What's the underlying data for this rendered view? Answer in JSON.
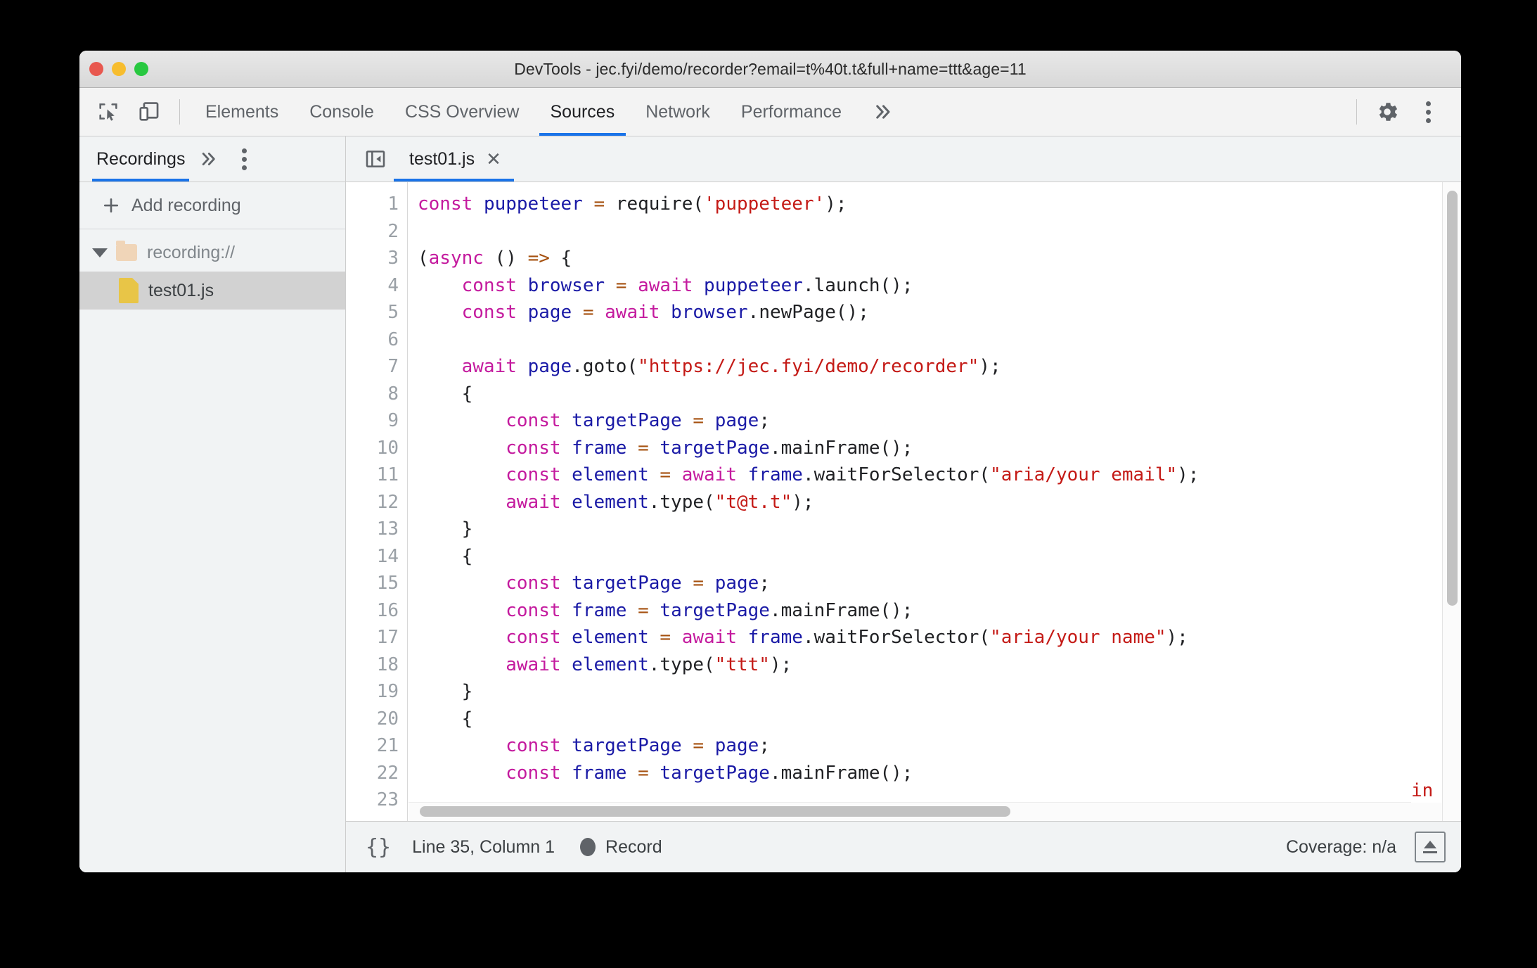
{
  "window": {
    "title": "DevTools - jec.fyi/demo/recorder?email=t%40t.t&full+name=ttt&age=11",
    "traffic_lights": {
      "close_color": "#e8584f",
      "minimize_color": "#f7bd2e",
      "maximize_color": "#28c840"
    }
  },
  "toolbar": {
    "inspect_icon": "inspect-element-icon",
    "device_icon": "device-toolbar-icon",
    "tabs": [
      {
        "label": "Elements",
        "active": false
      },
      {
        "label": "Console",
        "active": false
      },
      {
        "label": "CSS Overview",
        "active": false
      },
      {
        "label": "Sources",
        "active": true
      },
      {
        "label": "Network",
        "active": false
      },
      {
        "label": "Performance",
        "active": false
      }
    ],
    "more_tabs_icon": "chevron-double-right-icon",
    "settings_icon": "gear-icon",
    "menu_icon": "more-vertical-icon",
    "accent_color": "#1a73e8"
  },
  "sidebar": {
    "tab_label": "Recordings",
    "more_icon": "chevron-double-right-icon",
    "menu_icon": "more-vertical-icon",
    "add_recording_label": "Add recording",
    "add_icon": "plus-icon",
    "tree": [
      {
        "label": "recording://",
        "type": "folder",
        "expanded": true,
        "icon": "folder-icon",
        "twisty": "triangle-down-icon"
      },
      {
        "label": "test01.js",
        "type": "file",
        "selected": true,
        "icon": "js-file-icon"
      }
    ]
  },
  "editor": {
    "sidebar_toggle_icon": "show-navigator-icon",
    "tab_label": "test01.js",
    "close_icon": "close-icon",
    "lines": [
      {
        "n": "1",
        "tokens": [
          {
            "t": "const",
            "c": "kw"
          },
          {
            "t": " ",
            "c": "pl"
          },
          {
            "t": "puppeteer",
            "c": "var"
          },
          {
            "t": " ",
            "c": "pl"
          },
          {
            "t": "=",
            "c": "op"
          },
          {
            "t": " require(",
            "c": "pl"
          },
          {
            "t": "'puppeteer'",
            "c": "str"
          },
          {
            "t": ");",
            "c": "pl"
          }
        ]
      },
      {
        "n": "2",
        "tokens": []
      },
      {
        "n": "3",
        "tokens": [
          {
            "t": "(",
            "c": "pl"
          },
          {
            "t": "async",
            "c": "kw"
          },
          {
            "t": " () ",
            "c": "pl"
          },
          {
            "t": "=>",
            "c": "op"
          },
          {
            "t": " {",
            "c": "pl"
          }
        ]
      },
      {
        "n": "4",
        "tokens": [
          {
            "t": "    ",
            "c": "pl"
          },
          {
            "t": "const",
            "c": "kw"
          },
          {
            "t": " ",
            "c": "pl"
          },
          {
            "t": "browser",
            "c": "var"
          },
          {
            "t": " ",
            "c": "pl"
          },
          {
            "t": "=",
            "c": "op"
          },
          {
            "t": " ",
            "c": "pl"
          },
          {
            "t": "await",
            "c": "kw"
          },
          {
            "t": " ",
            "c": "pl"
          },
          {
            "t": "puppeteer",
            "c": "var"
          },
          {
            "t": ".launch();",
            "c": "pl"
          }
        ]
      },
      {
        "n": "5",
        "tokens": [
          {
            "t": "    ",
            "c": "pl"
          },
          {
            "t": "const",
            "c": "kw"
          },
          {
            "t": " ",
            "c": "pl"
          },
          {
            "t": "page",
            "c": "var"
          },
          {
            "t": " ",
            "c": "pl"
          },
          {
            "t": "=",
            "c": "op"
          },
          {
            "t": " ",
            "c": "pl"
          },
          {
            "t": "await",
            "c": "kw"
          },
          {
            "t": " ",
            "c": "pl"
          },
          {
            "t": "browser",
            "c": "var"
          },
          {
            "t": ".newPage();",
            "c": "pl"
          }
        ]
      },
      {
        "n": "6",
        "tokens": []
      },
      {
        "n": "7",
        "tokens": [
          {
            "t": "    ",
            "c": "pl"
          },
          {
            "t": "await",
            "c": "kw"
          },
          {
            "t": " ",
            "c": "pl"
          },
          {
            "t": "page",
            "c": "var"
          },
          {
            "t": ".goto(",
            "c": "pl"
          },
          {
            "t": "\"https://jec.fyi/demo/recorder\"",
            "c": "str"
          },
          {
            "t": ");",
            "c": "pl"
          }
        ]
      },
      {
        "n": "8",
        "tokens": [
          {
            "t": "    {",
            "c": "pl"
          }
        ]
      },
      {
        "n": "9",
        "tokens": [
          {
            "t": "        ",
            "c": "pl"
          },
          {
            "t": "const",
            "c": "kw"
          },
          {
            "t": " ",
            "c": "pl"
          },
          {
            "t": "targetPage",
            "c": "var"
          },
          {
            "t": " ",
            "c": "pl"
          },
          {
            "t": "=",
            "c": "op"
          },
          {
            "t": " ",
            "c": "pl"
          },
          {
            "t": "page",
            "c": "var"
          },
          {
            "t": ";",
            "c": "pl"
          }
        ]
      },
      {
        "n": "10",
        "tokens": [
          {
            "t": "        ",
            "c": "pl"
          },
          {
            "t": "const",
            "c": "kw"
          },
          {
            "t": " ",
            "c": "pl"
          },
          {
            "t": "frame",
            "c": "var"
          },
          {
            "t": " ",
            "c": "pl"
          },
          {
            "t": "=",
            "c": "op"
          },
          {
            "t": " ",
            "c": "pl"
          },
          {
            "t": "targetPage",
            "c": "var"
          },
          {
            "t": ".mainFrame();",
            "c": "pl"
          }
        ]
      },
      {
        "n": "11",
        "tokens": [
          {
            "t": "        ",
            "c": "pl"
          },
          {
            "t": "const",
            "c": "kw"
          },
          {
            "t": " ",
            "c": "pl"
          },
          {
            "t": "element",
            "c": "var"
          },
          {
            "t": " ",
            "c": "pl"
          },
          {
            "t": "=",
            "c": "op"
          },
          {
            "t": " ",
            "c": "pl"
          },
          {
            "t": "await",
            "c": "kw"
          },
          {
            "t": " ",
            "c": "pl"
          },
          {
            "t": "frame",
            "c": "var"
          },
          {
            "t": ".waitForSelector(",
            "c": "pl"
          },
          {
            "t": "\"aria/your email\"",
            "c": "str"
          },
          {
            "t": ");",
            "c": "pl"
          }
        ]
      },
      {
        "n": "12",
        "tokens": [
          {
            "t": "        ",
            "c": "pl"
          },
          {
            "t": "await",
            "c": "kw"
          },
          {
            "t": " ",
            "c": "pl"
          },
          {
            "t": "element",
            "c": "var"
          },
          {
            "t": ".type(",
            "c": "pl"
          },
          {
            "t": "\"t@t.t\"",
            "c": "str"
          },
          {
            "t": ");",
            "c": "pl"
          }
        ]
      },
      {
        "n": "13",
        "tokens": [
          {
            "t": "    }",
            "c": "pl"
          }
        ]
      },
      {
        "n": "14",
        "tokens": [
          {
            "t": "    {",
            "c": "pl"
          }
        ]
      },
      {
        "n": "15",
        "tokens": [
          {
            "t": "        ",
            "c": "pl"
          },
          {
            "t": "const",
            "c": "kw"
          },
          {
            "t": " ",
            "c": "pl"
          },
          {
            "t": "targetPage",
            "c": "var"
          },
          {
            "t": " ",
            "c": "pl"
          },
          {
            "t": "=",
            "c": "op"
          },
          {
            "t": " ",
            "c": "pl"
          },
          {
            "t": "page",
            "c": "var"
          },
          {
            "t": ";",
            "c": "pl"
          }
        ]
      },
      {
        "n": "16",
        "tokens": [
          {
            "t": "        ",
            "c": "pl"
          },
          {
            "t": "const",
            "c": "kw"
          },
          {
            "t": " ",
            "c": "pl"
          },
          {
            "t": "frame",
            "c": "var"
          },
          {
            "t": " ",
            "c": "pl"
          },
          {
            "t": "=",
            "c": "op"
          },
          {
            "t": " ",
            "c": "pl"
          },
          {
            "t": "targetPage",
            "c": "var"
          },
          {
            "t": ".mainFrame();",
            "c": "pl"
          }
        ]
      },
      {
        "n": "17",
        "tokens": [
          {
            "t": "        ",
            "c": "pl"
          },
          {
            "t": "const",
            "c": "kw"
          },
          {
            "t": " ",
            "c": "pl"
          },
          {
            "t": "element",
            "c": "var"
          },
          {
            "t": " ",
            "c": "pl"
          },
          {
            "t": "=",
            "c": "op"
          },
          {
            "t": " ",
            "c": "pl"
          },
          {
            "t": "await",
            "c": "kw"
          },
          {
            "t": " ",
            "c": "pl"
          },
          {
            "t": "frame",
            "c": "var"
          },
          {
            "t": ".waitForSelector(",
            "c": "pl"
          },
          {
            "t": "\"aria/your name\"",
            "c": "str"
          },
          {
            "t": ");",
            "c": "pl"
          }
        ]
      },
      {
        "n": "18",
        "tokens": [
          {
            "t": "        ",
            "c": "pl"
          },
          {
            "t": "await",
            "c": "kw"
          },
          {
            "t": " ",
            "c": "pl"
          },
          {
            "t": "element",
            "c": "var"
          },
          {
            "t": ".type(",
            "c": "pl"
          },
          {
            "t": "\"ttt\"",
            "c": "str"
          },
          {
            "t": ");",
            "c": "pl"
          }
        ]
      },
      {
        "n": "19",
        "tokens": [
          {
            "t": "    }",
            "c": "pl"
          }
        ]
      },
      {
        "n": "20",
        "tokens": [
          {
            "t": "    {",
            "c": "pl"
          }
        ]
      },
      {
        "n": "21",
        "tokens": [
          {
            "t": "        ",
            "c": "pl"
          },
          {
            "t": "const",
            "c": "kw"
          },
          {
            "t": " ",
            "c": "pl"
          },
          {
            "t": "targetPage",
            "c": "var"
          },
          {
            "t": " ",
            "c": "pl"
          },
          {
            "t": "=",
            "c": "op"
          },
          {
            "t": " ",
            "c": "pl"
          },
          {
            "t": "page",
            "c": "var"
          },
          {
            "t": ";",
            "c": "pl"
          }
        ]
      },
      {
        "n": "22",
        "tokens": [
          {
            "t": "        ",
            "c": "pl"
          },
          {
            "t": "const",
            "c": "kw"
          },
          {
            "t": " ",
            "c": "pl"
          },
          {
            "t": "frame",
            "c": "var"
          },
          {
            "t": " ",
            "c": "pl"
          },
          {
            "t": "=",
            "c": "op"
          },
          {
            "t": " ",
            "c": "pl"
          },
          {
            "t": "targetPage",
            "c": "var"
          },
          {
            "t": ".mainFrame();",
            "c": "pl"
          }
        ]
      },
      {
        "n": "23",
        "tokens": []
      }
    ],
    "clipped_fragment": "in",
    "syntax_colors": {
      "keyword": "#c41a9e",
      "variable": "#1a1aa6",
      "operator": "#a5500f",
      "string": "#c41a16",
      "plain": "#202124",
      "line_number": "#9aa0a6"
    }
  },
  "status_bar": {
    "pretty_print_label": "{}",
    "cursor_position": "Line 35, Column 1",
    "record_label": "Record",
    "record_icon": "record-dot-icon",
    "coverage_label": "Coverage: n/a",
    "drawer_toggle_icon": "show-drawer-icon"
  }
}
